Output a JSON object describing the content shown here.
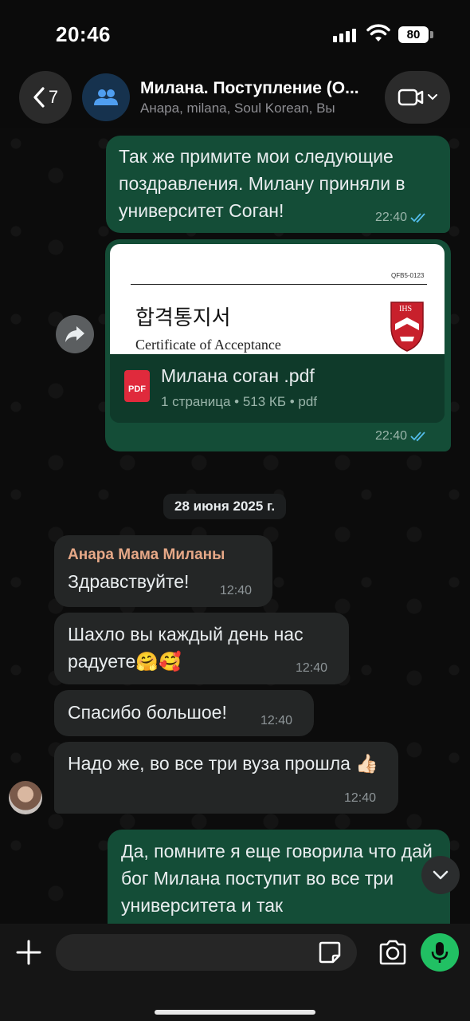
{
  "status_bar": {
    "time": "20:46",
    "battery": "80"
  },
  "header": {
    "back_count": "7",
    "title": "Милана. Поступление (О...",
    "subtitle": "Анара, milana, Soul Korean, Вы"
  },
  "messages": {
    "m1": {
      "text": "Так же примите мои следующие поздравления. Милану приняли в университет Соган!",
      "time": "22:40"
    },
    "doc": {
      "code": "QFB5-0123",
      "korean_title": "합격통지서",
      "english_title": "Certificate of Acceptance",
      "logo_text": "IHS",
      "file_type_badge": "PDF",
      "file_name": "Милана соган .pdf",
      "file_details": "1 страница • 513 КБ • pdf",
      "time": "22:40"
    },
    "date_divider": "28 июня 2025 г.",
    "m3": {
      "sender": "Анара Мама Миланы",
      "text": "Здравствуйте!",
      "time": "12:40"
    },
    "m4": {
      "text": "Шахло вы каждый день нас радуете🤗🥰",
      "time": "12:40"
    },
    "m5": {
      "text": "Спасибо большое!",
      "time": "12:40"
    },
    "m6": {
      "text": "Надо же, во все три вуза прошла 👍🏻",
      "time": "12:40"
    },
    "m7": {
      "text": "Да, помните я еще говорила что дай бог Милана поступит во все три университета и так"
    }
  },
  "icons": {
    "back": "chevron-left-icon",
    "group": "people-icon",
    "video": "video-camera-icon",
    "forward": "forward-arrow-icon",
    "read": "double-check-icon",
    "scroll": "chevron-down-icon",
    "plus": "plus-icon",
    "sticker": "sticker-icon",
    "camera": "camera-icon",
    "mic": "microphone-icon"
  },
  "colors": {
    "outgoing_bubble": "#144d37",
    "incoming_bubble": "#242626",
    "sender_name": "#e6a887",
    "read_ticks": "#53bdeb",
    "mic_button": "#21c063"
  }
}
